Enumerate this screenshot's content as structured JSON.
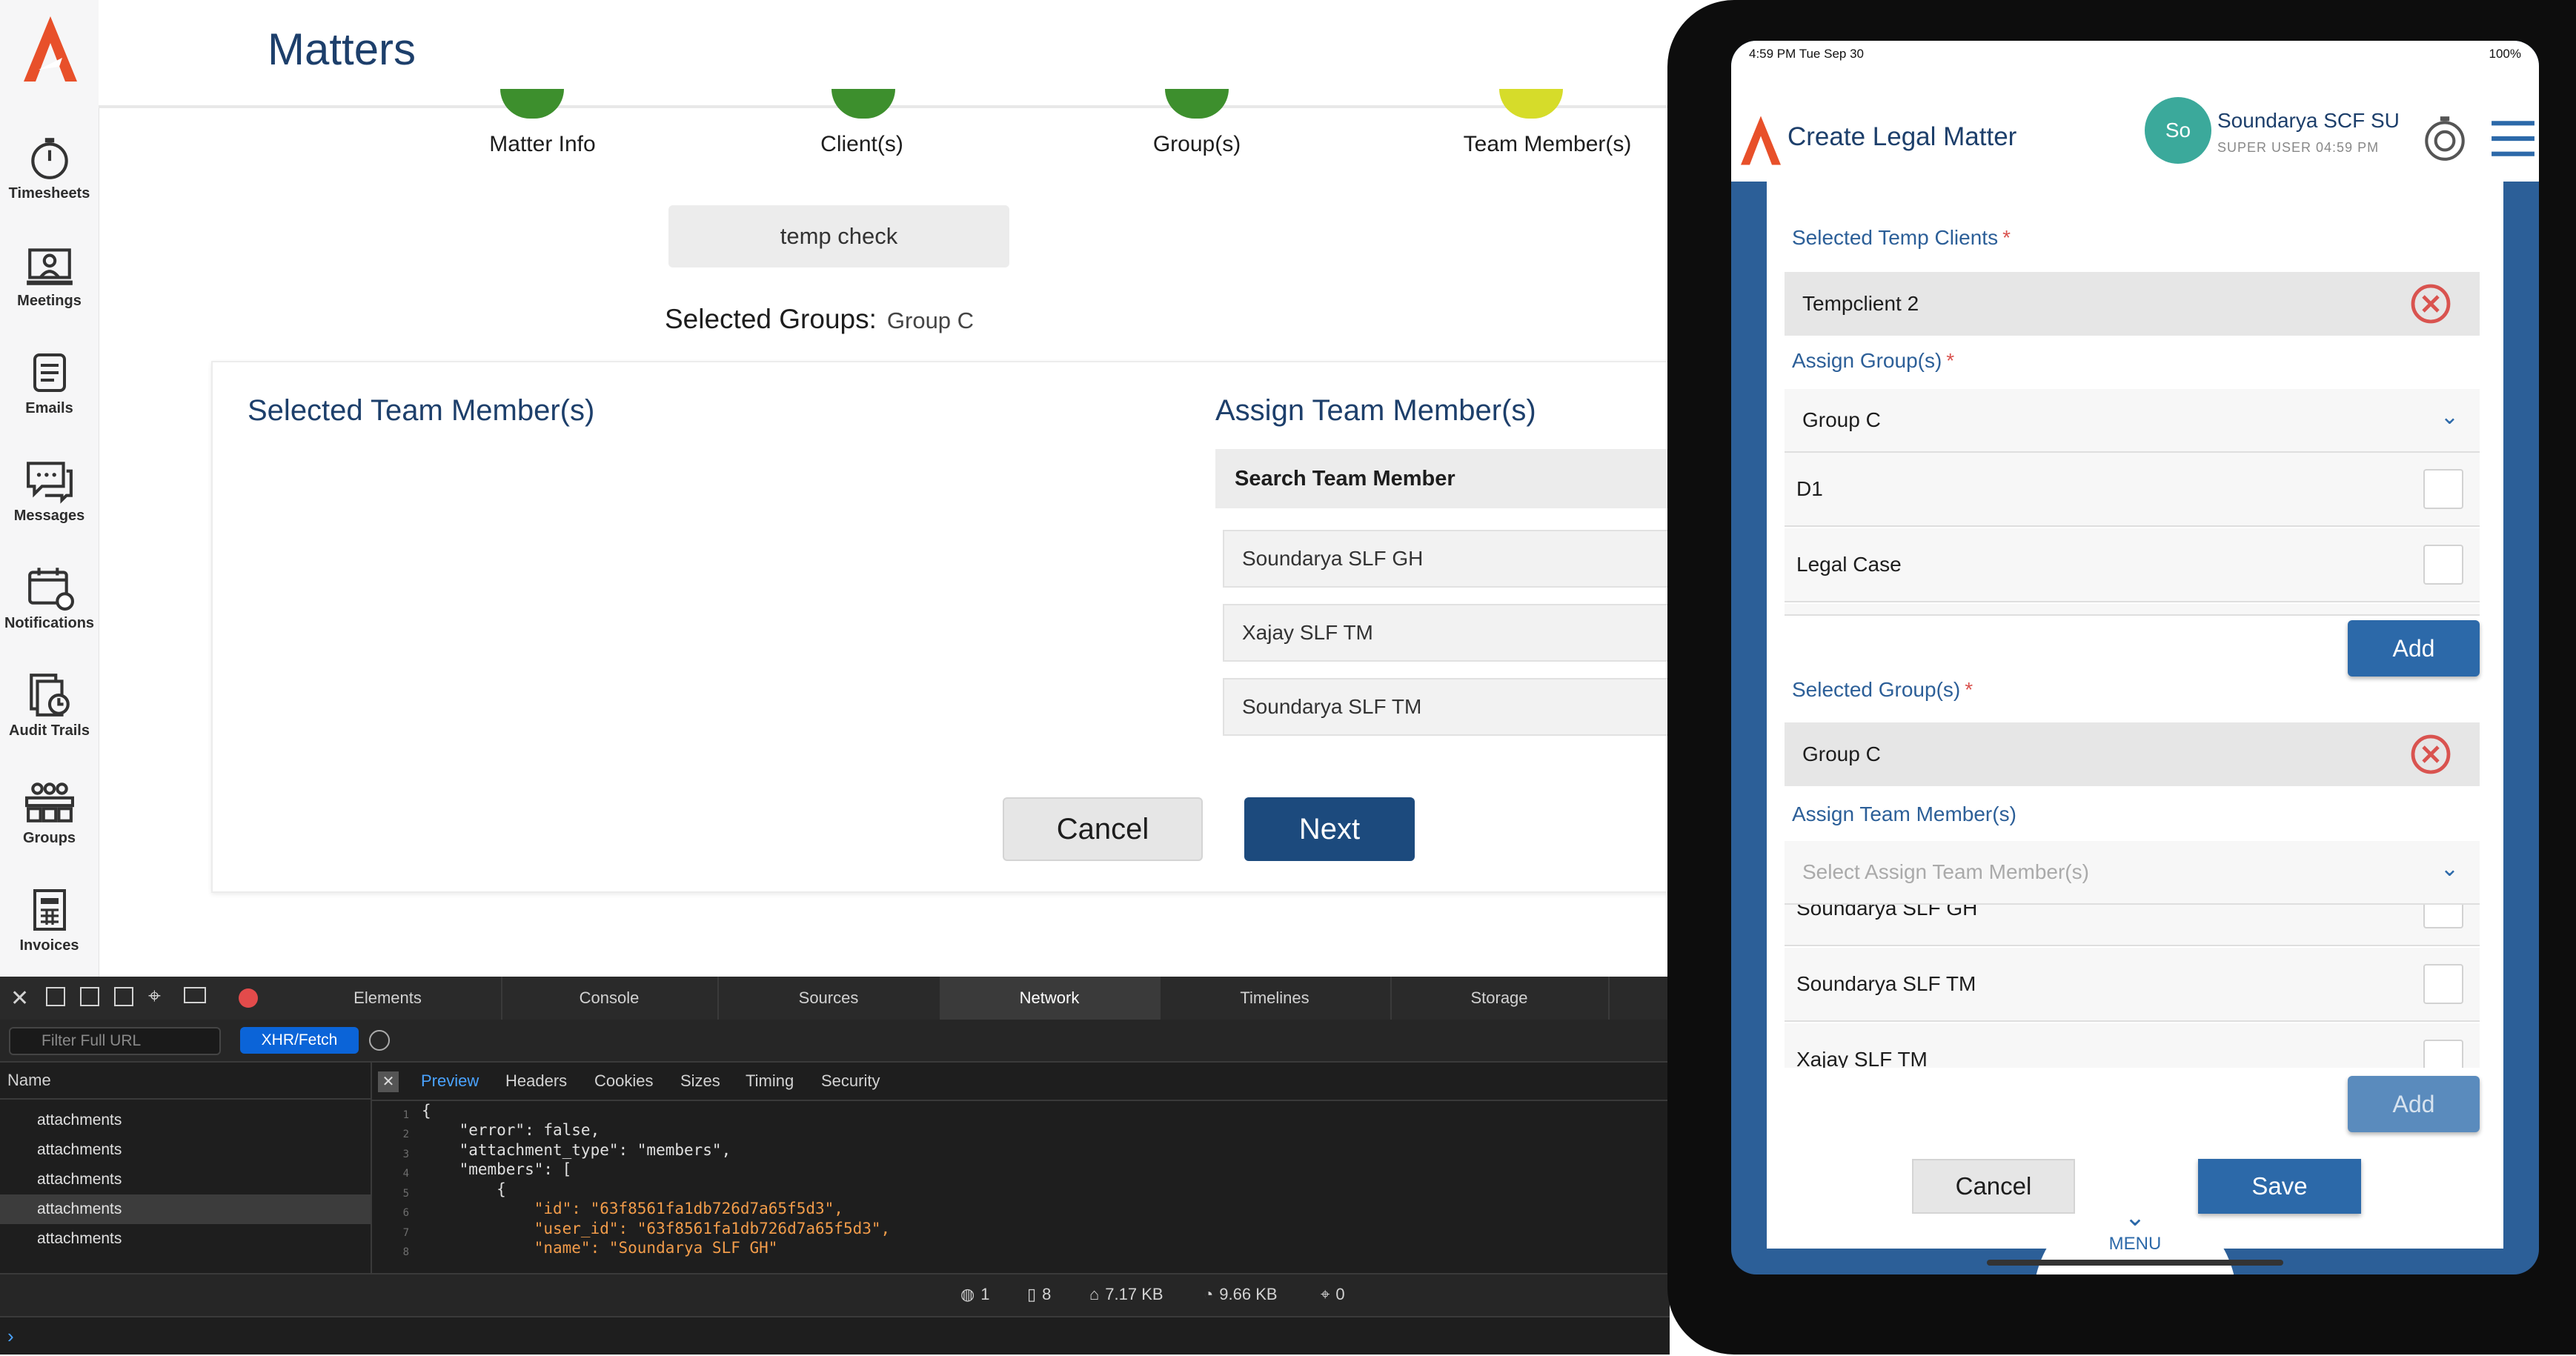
{
  "sidebar": {
    "items": [
      {
        "label": "Timesheets",
        "icon": "stopwatch-icon"
      },
      {
        "label": "Meetings",
        "icon": "meeting-icon"
      },
      {
        "label": "Emails",
        "icon": "email-icon"
      },
      {
        "label": "Messages",
        "icon": "messages-icon"
      },
      {
        "label": "Notifications",
        "icon": "calendar-bell-icon"
      },
      {
        "label": "Audit Trails",
        "icon": "audit-icon"
      },
      {
        "label": "Groups",
        "icon": "groups-icon"
      },
      {
        "label": "Invoices",
        "icon": "invoice-icon"
      }
    ]
  },
  "main": {
    "title": "Matters",
    "steps": [
      "Matter Info",
      "Client(s)",
      "Group(s)",
      "Team Member(s)"
    ],
    "temp_client": "temp check",
    "selected_groups_label": "Selected Groups:",
    "selected_groups_value": "Group C",
    "selected_team_heading": "Selected Team Member(s)",
    "assign_team_heading": "Assign Team Member(s)",
    "search_placeholder": "Search Team Member",
    "team_members": [
      "Soundarya SLF GH",
      "Xajay SLF TM",
      "Soundarya SLF TM"
    ],
    "cancel": "Cancel",
    "next": "Next"
  },
  "devtools": {
    "tabs": [
      "Elements",
      "Console",
      "Sources",
      "Network",
      "Timelines",
      "Storage"
    ],
    "active_tab": "Network",
    "filter_placeholder": "Filter Full URL",
    "xhr_filter": "XHR/Fetch",
    "name_header": "Name",
    "requests": [
      "attachments",
      "attachments",
      "attachments",
      "attachments",
      "attachments"
    ],
    "preview_tabs": [
      "Preview",
      "Headers",
      "Cookies",
      "Sizes",
      "Timing",
      "Security"
    ],
    "code_lines": [
      "{",
      "    \"error\": false,",
      "    \"attachment_type\": \"members\",",
      "    \"members\": [",
      "        {",
      "            \"id\": \"63f8561fa1db726d7a65f5d3\",",
      "            \"user_id\": \"63f8561fa1db726d7a65f5d3\",",
      "            \"name\": \"Soundarya SLF GH\""
    ],
    "status": {
      "errors": "1",
      "resources": "8",
      "transferred": "7.17 KB",
      "size": "9.66 KB",
      "time": "0"
    }
  },
  "ipad": {
    "time": "4:59 PM   Tue Sep 30",
    "battery": "100%",
    "app_title": "Create Legal Matter",
    "avatar": "So",
    "user_name": "Soundarya SCF SU",
    "user_role": "SUPER USER  04:59 PM",
    "selected_temp_label": "Selected Temp Clients",
    "selected_temp_value": "Tempclient 2",
    "assign_groups_label": "Assign Group(s)",
    "group_dropdown_value": "Group C",
    "group_options": [
      "D1",
      "Legal Case"
    ],
    "add": "Add",
    "selected_groups_label": "Selected Group(s)",
    "selected_group_value": "Group C",
    "assign_team_label": "Assign Team Member(s)",
    "team_placeholder": "Select Assign Team Member(s)",
    "team_options": [
      "Soundarya SLF GH",
      "Soundarya SLF TM",
      "Xajay SLF TM"
    ],
    "cancel": "Cancel",
    "save": "Save",
    "menu": "MENU"
  },
  "colors": {
    "brand": "#1d3f6b",
    "accent": "#2c69a9",
    "logo": "#e8502a",
    "step_done": "#3d8f2d",
    "step_active": "#d6dc2a"
  }
}
